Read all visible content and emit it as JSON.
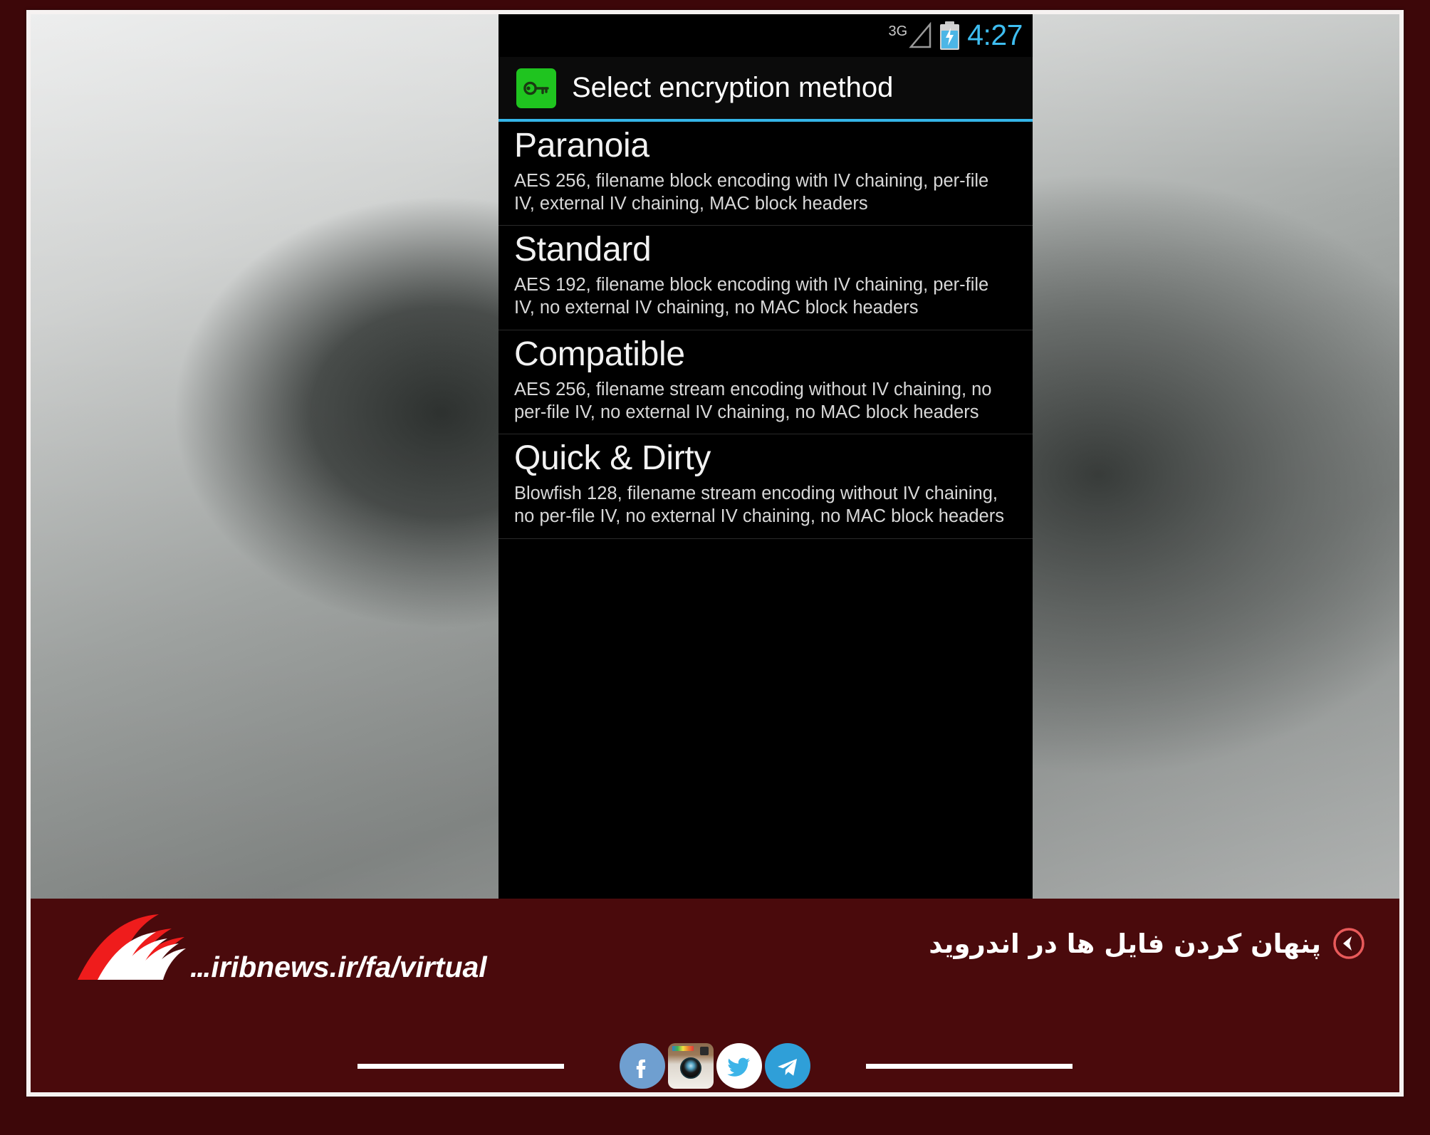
{
  "phone": {
    "status_bar": {
      "network_label": "3G",
      "battery_state": "charging",
      "clock": "4:27"
    },
    "title_bar": {
      "icon": "key-icon",
      "title": "Select encryption method",
      "accent_color": "#34b5e8",
      "icon_bg_color": "#1fc41f"
    },
    "list_items": [
      {
        "title": "Paranoia",
        "description": "AES 256, filename block encoding with IV chaining, per-file IV, external IV chaining, MAC block headers"
      },
      {
        "title": "Standard",
        "description": "AES 192, filename block encoding with IV chaining, per-file IV, no external IV chaining, no MAC block headers"
      },
      {
        "title": "Compatible",
        "description": "AES 256, filename stream encoding without IV chaining, no per-file IV, no external IV chaining, no MAC block headers"
      },
      {
        "title": "Quick & Dirty",
        "description": "Blowfish 128, filename stream encoding without IV chaining, no per-file IV, no external IV chaining, no MAC block headers"
      }
    ]
  },
  "banner": {
    "background_color": "#4a0a0c",
    "logo": {
      "name": "irib-logo",
      "dots": "...",
      "url": "iribnews.ir/fa/virtual",
      "primary_color": "#ef1c1c"
    },
    "headline": {
      "text": "پنهان کردن فایل ها در اندروید",
      "back_icon": "back-chevron-icon"
    },
    "social": [
      {
        "name": "facebook-icon",
        "label": "f"
      },
      {
        "name": "instagram-icon",
        "label": ""
      },
      {
        "name": "twitter-icon",
        "label": ""
      },
      {
        "name": "telegram-icon",
        "label": ""
      }
    ]
  }
}
